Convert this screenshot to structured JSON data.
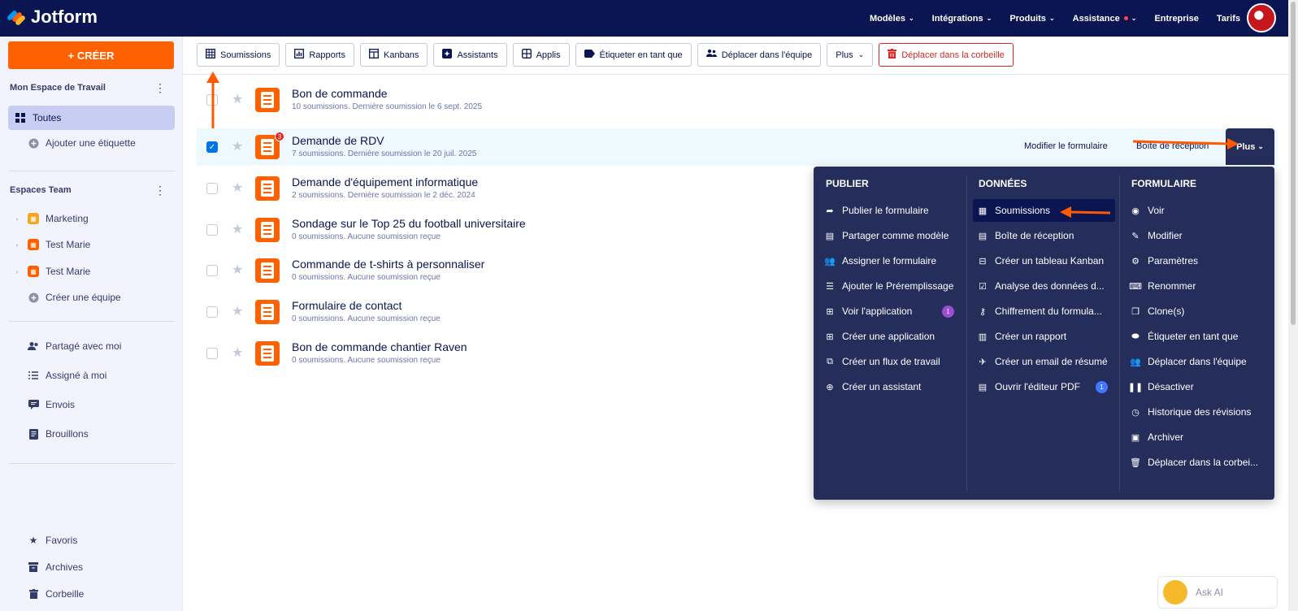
{
  "topbar": {
    "brand": "Jotform",
    "nav": [
      {
        "label": "Modèles",
        "chevron": true,
        "dot": false
      },
      {
        "label": "Intégrations",
        "chevron": true,
        "dot": false
      },
      {
        "label": "Produits",
        "chevron": true,
        "dot": false
      },
      {
        "label": "Assistance",
        "chevron": true,
        "dot": true
      },
      {
        "label": "Entreprise",
        "chevron": false,
        "dot": false
      },
      {
        "label": "Tarifs",
        "chevron": false,
        "dot": false
      }
    ]
  },
  "sidebar": {
    "create_label": "+ CRÉER",
    "workspace_heading": "Mon Espace de Travail",
    "all_label": "Toutes",
    "add_tag_label": "Ajouter une étiquette",
    "teams_heading": "Espaces Team",
    "teams": [
      {
        "label": "Marketing",
        "color": "#f5a623"
      },
      {
        "label": "Test Marie",
        "color": "#ff6100"
      },
      {
        "label": "Test Marie",
        "color": "#ff6100"
      }
    ],
    "create_team_label": "Créer une équipe",
    "shared_label": "Partagé avec moi",
    "assigned_label": "Assigné à moi",
    "sent_label": "Envois",
    "drafts_label": "Brouillons",
    "favorites_label": "Favoris",
    "archives_label": "Archives",
    "trash_label": "Corbeille"
  },
  "toolbar": {
    "submissions": "Soumissions",
    "reports": "Rapports",
    "kanbans": "Kanbans",
    "assistants": "Assistants",
    "apps": "Applis",
    "tag_as": "Étiqueter en tant que",
    "move_team": "Déplacer dans l'équipe",
    "more": "Plus",
    "trash": "Déplacer dans la corbeille"
  },
  "forms": [
    {
      "title": "Bon de commande",
      "subtitle": "10 soumissions. Dernière soumission le 6 sept. 2025",
      "selected": false,
      "badge": ""
    },
    {
      "title": "Demande de RDV",
      "subtitle": "7 soumissions. Dernière soumission le 20 juil. 2025",
      "selected": true,
      "badge": "3"
    },
    {
      "title": "Demande d'équipement informatique",
      "subtitle": "2 soumissions. Dernière soumission le 2 déc. 2024",
      "selected": false,
      "badge": ""
    },
    {
      "title": "Sondage sur le Top 25 du football universitaire",
      "subtitle": "0 soumissions. Aucune soumission reçue",
      "selected": false,
      "badge": ""
    },
    {
      "title": "Commande de t-shirts à personnaliser",
      "subtitle": "0 soumissions. Aucune soumission reçue",
      "selected": false,
      "badge": ""
    },
    {
      "title": "Formulaire de contact",
      "subtitle": "0 soumissions. Aucune soumission reçue",
      "selected": false,
      "badge": ""
    },
    {
      "title": "Bon de commande chantier Raven",
      "subtitle": "0 soumissions. Aucune soumission reçue",
      "selected": false,
      "badge": ""
    }
  ],
  "row_actions": {
    "edit_form": "Modifier le formulaire",
    "inbox": "Boîte de réception",
    "more": "Plus"
  },
  "menu": {
    "publish": {
      "heading": "PUBLIER",
      "items": [
        {
          "label": "Publier le formulaire",
          "icon": "share-arrow-icon"
        },
        {
          "label": "Partager comme modèle",
          "icon": "template-icon"
        },
        {
          "label": "Assigner le formulaire",
          "icon": "assign-user-icon"
        },
        {
          "label": "Ajouter le Préremplissage",
          "icon": "prefill-icon"
        },
        {
          "label": "Voir l'application",
          "icon": "app-grid-icon",
          "badge": "1"
        },
        {
          "label": "Créer une application",
          "icon": "app-plus-icon"
        },
        {
          "label": "Créer un flux de travail",
          "icon": "workflow-icon"
        },
        {
          "label": "Créer un assistant",
          "icon": "plus-circle-icon"
        }
      ]
    },
    "data": {
      "heading": "DONNÉES",
      "items": [
        {
          "label": "Soumissions",
          "icon": "table-icon",
          "highlighted": true
        },
        {
          "label": "Boîte de réception",
          "icon": "inbox-icon"
        },
        {
          "label": "Créer un tableau Kanban",
          "icon": "kanban-icon"
        },
        {
          "label": "Analyse des données d...",
          "icon": "analytics-icon"
        },
        {
          "label": "Chiffrement du formula...",
          "icon": "key-icon"
        },
        {
          "label": "Créer un rapport",
          "icon": "report-icon"
        },
        {
          "label": "Créer un email de résumé",
          "icon": "email-icon"
        },
        {
          "label": "Ouvrir l'éditeur PDF",
          "icon": "pdf-icon",
          "badge": "1"
        }
      ]
    },
    "form": {
      "heading": "FORMULAIRE",
      "items": [
        {
          "label": "Voir",
          "icon": "eye-icon"
        },
        {
          "label": "Modifier",
          "icon": "edit-icon"
        },
        {
          "label": "Paramètres",
          "icon": "gear-icon"
        },
        {
          "label": "Renommer",
          "icon": "rename-icon"
        },
        {
          "label": "Clone(s)",
          "icon": "clone-icon"
        },
        {
          "label": "Étiqueter en tant que",
          "icon": "tag-icon"
        },
        {
          "label": "Déplacer dans l'équipe",
          "icon": "team-move-icon"
        },
        {
          "label": "Désactiver",
          "icon": "pause-icon"
        },
        {
          "label": "Historique des révisions",
          "icon": "history-icon"
        },
        {
          "label": "Archiver",
          "icon": "archive-icon"
        },
        {
          "label": "Déplacer dans la corbei...",
          "icon": "trash-icon"
        }
      ]
    }
  },
  "ask_ai": "Ask AI",
  "colors": {
    "navy": "#0a1551",
    "orange": "#ff6100",
    "menu_bg": "#252d5b",
    "danger": "#dc2626",
    "badge_purple": "#9c4dd3",
    "badge_blue": "#4277ff"
  }
}
